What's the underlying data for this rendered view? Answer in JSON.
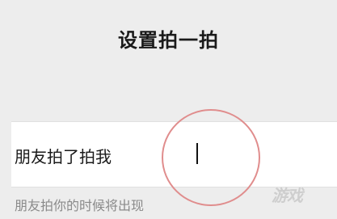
{
  "header": {
    "title": "设置拍一拍"
  },
  "pat_field": {
    "prefix": "朋友拍了拍我",
    "value": "",
    "placeholder": ""
  },
  "hint": {
    "text": "朋友拍你的时候将出现"
  },
  "watermark": {
    "text": "游戏"
  },
  "colors": {
    "background": "#ededed",
    "field_background": "#ffffff",
    "annotation_ring": "#e08d8d"
  }
}
